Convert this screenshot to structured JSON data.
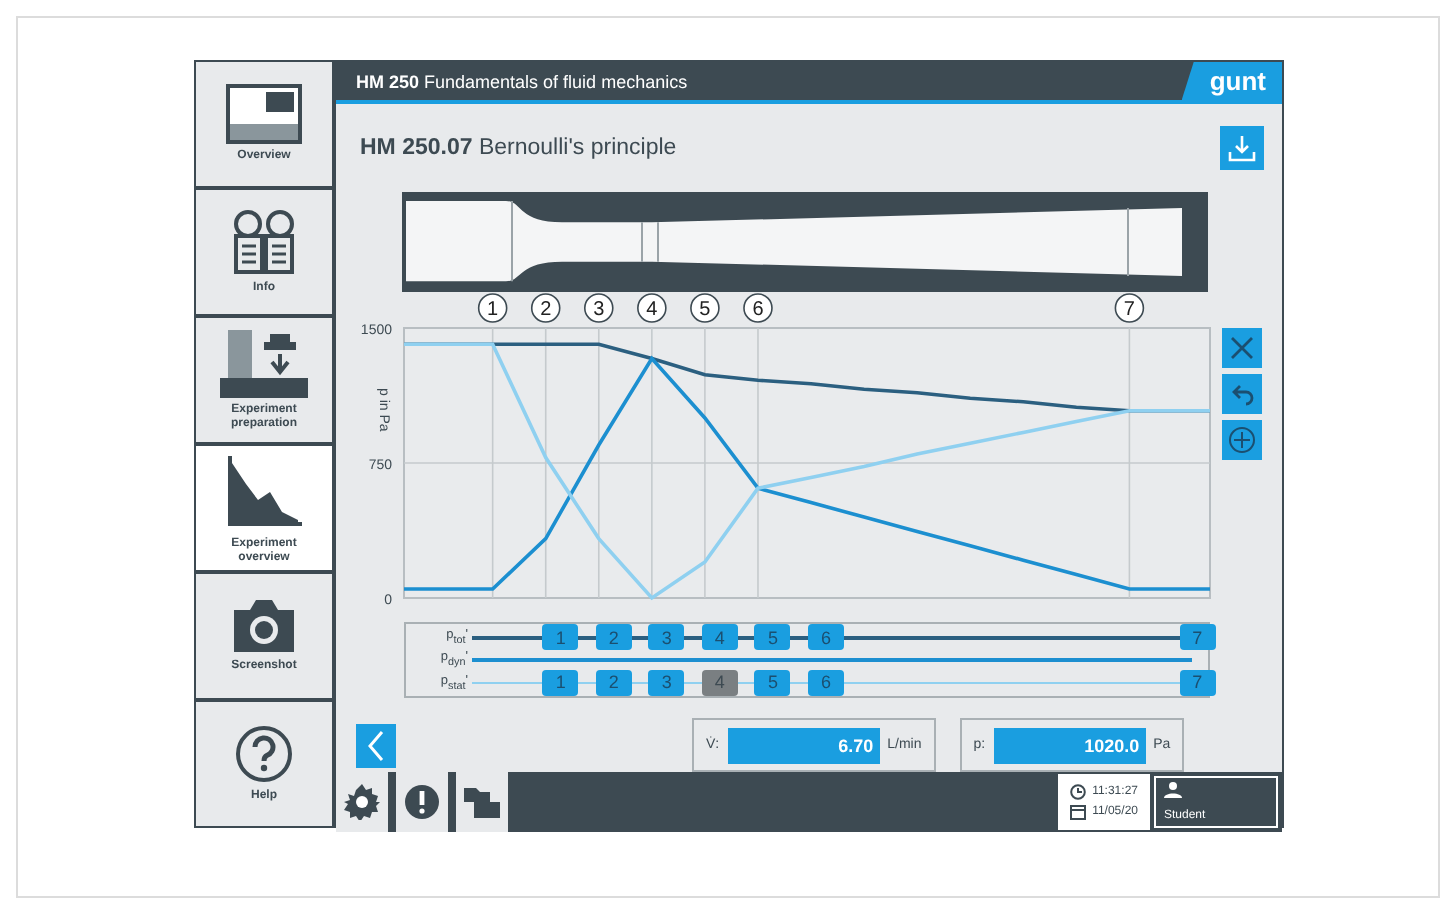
{
  "header": {
    "title": "**HM 250** Fundamentals of fluid mechanics",
    "logo": "gunt"
  },
  "sidebar": {
    "items": [
      {
        "label": "Overview",
        "selected": false
      },
      {
        "label": "Info",
        "selected": false
      },
      {
        "label": "Experiment preparation",
        "selected": false
      },
      {
        "label": "Experiment overview",
        "selected": true
      },
      {
        "label": "Screenshot",
        "selected": false
      },
      {
        "label": "Help",
        "selected": false
      }
    ]
  },
  "page_title": "**HM 250.07** Bernoulli's principle",
  "chart": {
    "chart_data": {
      "type": "line",
      "ylabel": "p in Pa",
      "categories": [
        "1",
        "2",
        "3",
        "4",
        "5",
        "6",
        null,
        null,
        null,
        null,
        null,
        null,
        "7"
      ],
      "ylim": [
        0,
        1500
      ],
      "yticks": [
        0,
        750,
        1500
      ],
      "grid": true,
      "series": [
        {
          "name": "p$_{tot}$'",
          "color": "#2b5f80",
          "values": [
            1410,
            1410,
            1410,
            1330,
            1240,
            1210,
            1190,
            1160,
            1140,
            1110,
            1090,
            1060,
            1040
          ]
        },
        {
          "name": "p$_{dyn}$'",
          "color": "#1c8fd0",
          "values": [
            50,
            330,
            850,
            1330,
            1000,
            610,
            530,
            450,
            370,
            290,
            210,
            130,
            50
          ]
        },
        {
          "name": "p$_{stat}$'",
          "color": "#8fd0f0",
          "values": [
            1410,
            780,
            330,
            0,
            200,
            610,
            670,
            730,
            800,
            860,
            920,
            980,
            1040
          ]
        }
      ]
    }
  },
  "legend": {
    "rows": [
      {
        "buttons": [
          {
            "label": "1",
            "on": true
          },
          {
            "label": "2",
            "on": true
          },
          {
            "label": "3",
            "on": true
          },
          {
            "label": "4",
            "on": true
          },
          {
            "label": "5",
            "on": true
          },
          {
            "label": "6",
            "on": true
          },
          {
            "label": "7",
            "on": true
          }
        ]
      },
      {
        "buttons": []
      },
      {
        "buttons": [
          {
            "label": "1",
            "on": true
          },
          {
            "label": "2",
            "on": true
          },
          {
            "label": "3",
            "on": true
          },
          {
            "label": "4",
            "on": false
          },
          {
            "label": "5",
            "on": true
          },
          {
            "label": "6",
            "on": true
          },
          {
            "label": "7",
            "on": true
          }
        ]
      }
    ]
  },
  "flow": {
    "label": "V̇:",
    "value": "6.70",
    "unit": "L/min"
  },
  "pressure": {
    "label": "p:",
    "value": "1020.0",
    "unit": "Pa"
  },
  "status": {
    "time": "11:31:27",
    "date": "11/05/20",
    "user": "Student"
  }
}
